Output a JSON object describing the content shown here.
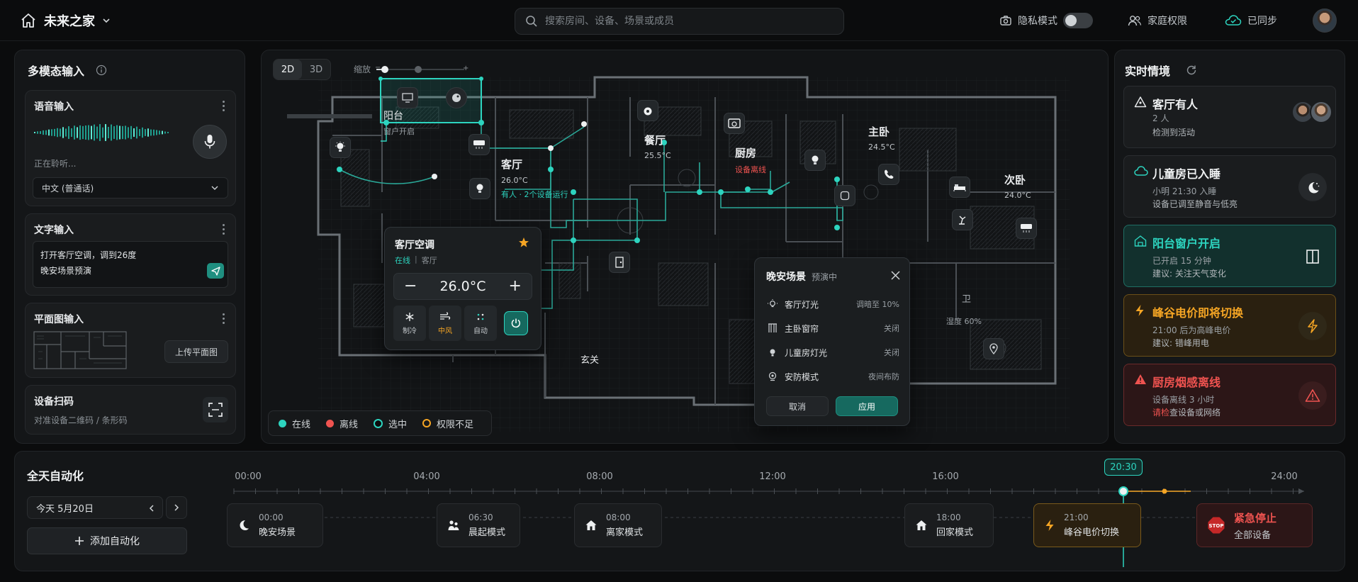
{
  "app": {
    "home_name": "未来之家"
  },
  "search": {
    "placeholder": "搜索房间、设备、场景或成员"
  },
  "topbar": {
    "privacy": "隐私模式",
    "family": "家庭权限",
    "sync": "已同步"
  },
  "left": {
    "title": "多模态输入",
    "voice": {
      "title": "语音输入",
      "status": "正在聆听...",
      "language": "中文 (普通话)"
    },
    "text": {
      "title": "文字输入",
      "line1": "打开客厅空调，调到26度",
      "line2": "晚安场景预演"
    },
    "floorplan": {
      "title": "平面图输入",
      "upload": "上传平面图"
    },
    "scan": {
      "title": "设备扫码",
      "hint": "对准设备二维码 / 条形码"
    }
  },
  "map": {
    "view_2d": "2D",
    "view_3d": "3D",
    "zoom_label": "缩放",
    "zoom_level": 0.1,
    "rooms": {
      "balcony": {
        "name": "阳台",
        "status": "窗户开启"
      },
      "living": {
        "name": "客厅",
        "temp": "26.0°C",
        "status": "有人 · 2个设备运行"
      },
      "dining": {
        "name": "餐厅",
        "temp": "25.5°C"
      },
      "kitchen": {
        "name": "厨房",
        "status": "设备离线"
      },
      "master": {
        "name": "主卧",
        "temp": "24.5°C"
      },
      "second": {
        "name": "次卧",
        "temp": "24.0°C"
      },
      "entrance": {
        "name": "玄关"
      },
      "bath": {
        "name": "卫",
        "humidity": "湿度 60%"
      }
    }
  },
  "ac": {
    "title": "客厅空调",
    "online": "在线",
    "room": "客厅",
    "temp": "26.0°C",
    "modes": [
      "制冷",
      "中风",
      "自动"
    ]
  },
  "scene": {
    "title": "晚安场景",
    "badge": "预演中",
    "rows": [
      {
        "label": "客厅灯光",
        "value": "调暗至 10%"
      },
      {
        "label": "主卧窗帘",
        "value": "关闭"
      },
      {
        "label": "儿童房灯光",
        "value": "关闭"
      },
      {
        "label": "安防模式",
        "value": "夜间布防"
      }
    ],
    "cancel": "取消",
    "apply": "应用"
  },
  "legend": [
    "在线",
    "离线",
    "选中",
    "权限不足"
  ],
  "right": {
    "title": "实时情境",
    "cards": [
      {
        "title": "客厅有人",
        "line1": "2 人",
        "line2": "检测到活动"
      },
      {
        "title": "儿童房已入睡",
        "line1": "小明 21:30 入睡",
        "line2": "设备已调至静音与低亮"
      },
      {
        "title": "阳台窗户开启",
        "line1": "已开启 15 分钟",
        "line2": "建议: 关注天气变化"
      },
      {
        "title": "峰谷电价即将切换",
        "line1": "21:00 后为高峰电价",
        "line2": "建议: 错峰用电"
      },
      {
        "title": "厨房烟感离线",
        "line1": "设备离线 3 小时",
        "line2_a": "请检",
        "line2_b": "查设备或网络"
      }
    ]
  },
  "bottom": {
    "title": "全天自动化",
    "date": "今天  5月20日",
    "add": "添加自动化",
    "now": "20:30",
    "ticks": [
      "00:00",
      "04:00",
      "08:00",
      "12:00",
      "16:00",
      "24:00"
    ],
    "events": [
      {
        "time": "00:00",
        "name": "晚安场景"
      },
      {
        "time": "06:30",
        "name": "晨起模式"
      },
      {
        "time": "08:00",
        "name": "离家模式"
      },
      {
        "time": "18:00",
        "name": "回家模式"
      },
      {
        "time": "21:00",
        "name": "峰谷电价切换"
      }
    ],
    "stop": {
      "title": "紧急停止",
      "sub": "全部设备",
      "sign": "STOP"
    }
  },
  "colors": {
    "accent": "#2dd4bf",
    "offline": "#ef5350",
    "warning": "#f5a524"
  }
}
